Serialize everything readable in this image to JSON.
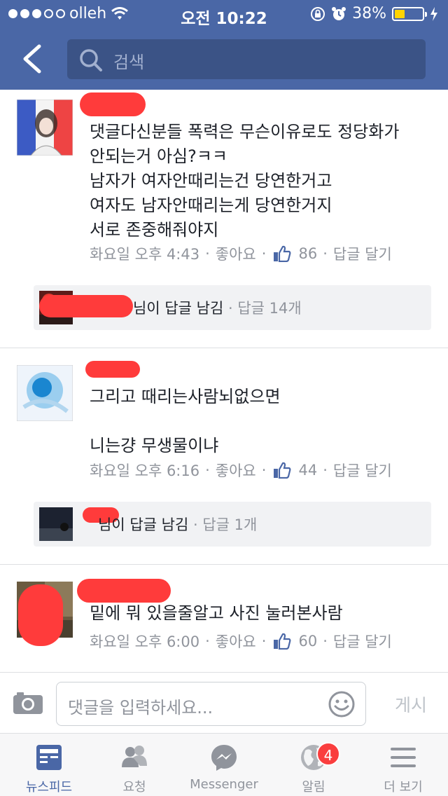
{
  "status_bar": {
    "carrier": "olleh",
    "time": "오전 10:22",
    "battery": "38%",
    "battery_level": 0.38
  },
  "nav": {
    "search_placeholder": "검색"
  },
  "comments": [
    {
      "text": "댓글다신분들 폭력은 무슨이유로도 정당화가\n안되는거 아심?ㅋㅋ\n남자가 여자안때리는건 당연한거고\n여자도 남자안때리는게 당연한거지\n서로 존중해줘야지",
      "time": "화요일 오후 4:43",
      "like_label": "좋아요",
      "like_count": "86",
      "reply_label": "답글 달기",
      "reply_summary": {
        "text": "님이 답글 남김",
        "count": "답글 14개"
      }
    },
    {
      "text": "그리고 때리는사람뇌없으면\n\n니는걍 무생물이냐",
      "time": "화요일 오후 6:16",
      "like_label": "좋아요",
      "like_count": "44",
      "reply_label": "답글 달기",
      "reply_summary": {
        "text": "님이 답글 남김",
        "count": "답글 1개"
      }
    },
    {
      "text": "밑에 뭐 있을줄알고 사진 눌러본사람",
      "time": "화요일 오후 6:00",
      "like_label": "좋아요",
      "like_count": "60",
      "reply_label": "답글 달기"
    }
  ],
  "composer": {
    "placeholder": "댓글을 입력하세요...",
    "post_label": "게시"
  },
  "tabbar": [
    {
      "label": "뉴스피드",
      "icon": "news-feed-icon",
      "active": true
    },
    {
      "label": "요청",
      "icon": "friend-requests-icon"
    },
    {
      "label": "Messenger",
      "icon": "messenger-icon"
    },
    {
      "label": "알림",
      "icon": "globe-notifications-icon",
      "badge": "4"
    },
    {
      "label": "더 보기",
      "icon": "menu-icon"
    }
  ],
  "colors": {
    "brand": "#4a67a6",
    "like": "#4a67a6",
    "badge": "#fa3e3e",
    "redaction": "#ff3b3b"
  }
}
